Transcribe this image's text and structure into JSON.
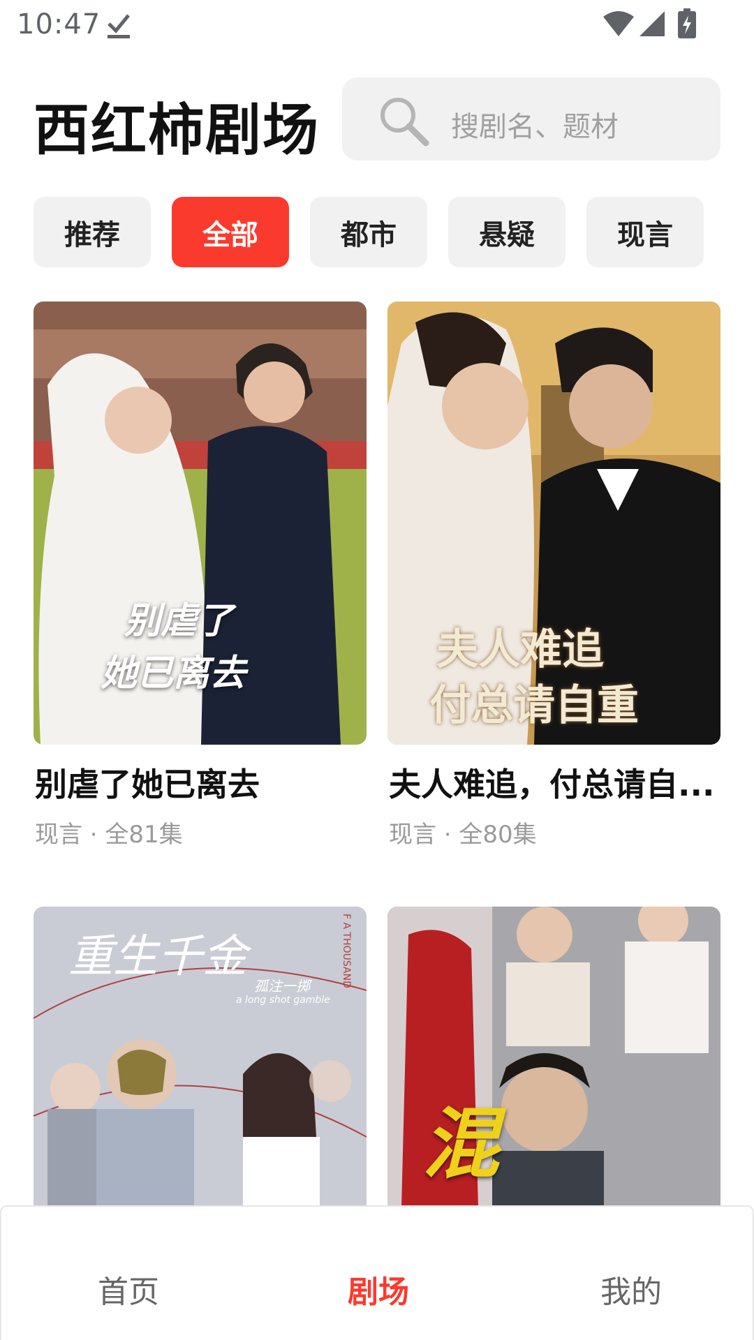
{
  "status_bar": {
    "time": "10:47",
    "icons": [
      "download-done-icon",
      "wifi-icon",
      "signal-icon",
      "battery-charging-icon"
    ]
  },
  "header": {
    "title": "西红柿剧场",
    "search_placeholder": "搜剧名、题材"
  },
  "tabs": [
    {
      "label": "推荐",
      "active": false
    },
    {
      "label": "全部",
      "active": true
    },
    {
      "label": "都市",
      "active": false
    },
    {
      "label": "悬疑",
      "active": false
    },
    {
      "label": "现言",
      "active": false
    }
  ],
  "dramas": [
    {
      "title": "别虐了她已离去",
      "meta": "现言 · 全81集",
      "poster_text": [
        "别虐了",
        "她已离去"
      ]
    },
    {
      "title": "夫人难追，付总请自...",
      "meta": "现言 · 全80集",
      "poster_text": [
        "夫人难追",
        "付总请自重"
      ]
    },
    {
      "title": "",
      "meta": "",
      "poster_text": [
        "重生千金",
        "孤注一掷",
        "a long shot gamble",
        "F A THOUSAND"
      ]
    },
    {
      "title": "",
      "meta": "",
      "poster_text": [
        "混"
      ]
    }
  ],
  "bottom_nav": [
    {
      "label": "首页",
      "active": false
    },
    {
      "label": "剧场",
      "active": true
    },
    {
      "label": "我的",
      "active": false
    }
  ],
  "colors": {
    "accent": "#fb3a2e",
    "tab_bg": "#f1f1f2",
    "meta_text": "#9a9a9a"
  }
}
